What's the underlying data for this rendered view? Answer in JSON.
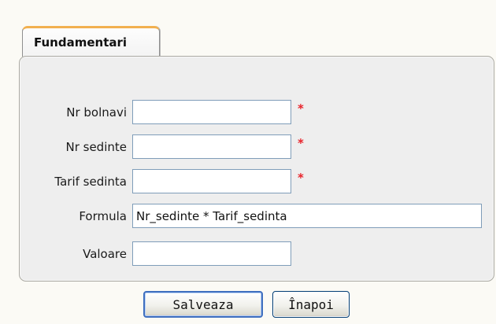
{
  "tab": {
    "label": "Fundamentari"
  },
  "form": {
    "nr_bolnavi": {
      "label": "Nr bolnavi",
      "value": "",
      "required_mark": "*"
    },
    "nr_sedinte": {
      "label": "Nr sedinte",
      "value": "",
      "required_mark": "*"
    },
    "tarif_sedinta": {
      "label": "Tarif sedinta",
      "value": "",
      "required_mark": "*"
    },
    "formula": {
      "label": "Formula",
      "value": "Nr_sedinte * Tarif_sedinta"
    },
    "valoare": {
      "label": "Valoare",
      "value": ""
    }
  },
  "buttons": {
    "save": {
      "label": "Salveaza",
      "accesskey": "S"
    },
    "back": {
      "label": "Înapoi",
      "accesskey": "p"
    }
  },
  "colors": {
    "required": "#e8222a",
    "tab_accent": "#f2b04f",
    "panel_bg": "#eeeeee",
    "page_bg": "#fbfaf5"
  }
}
